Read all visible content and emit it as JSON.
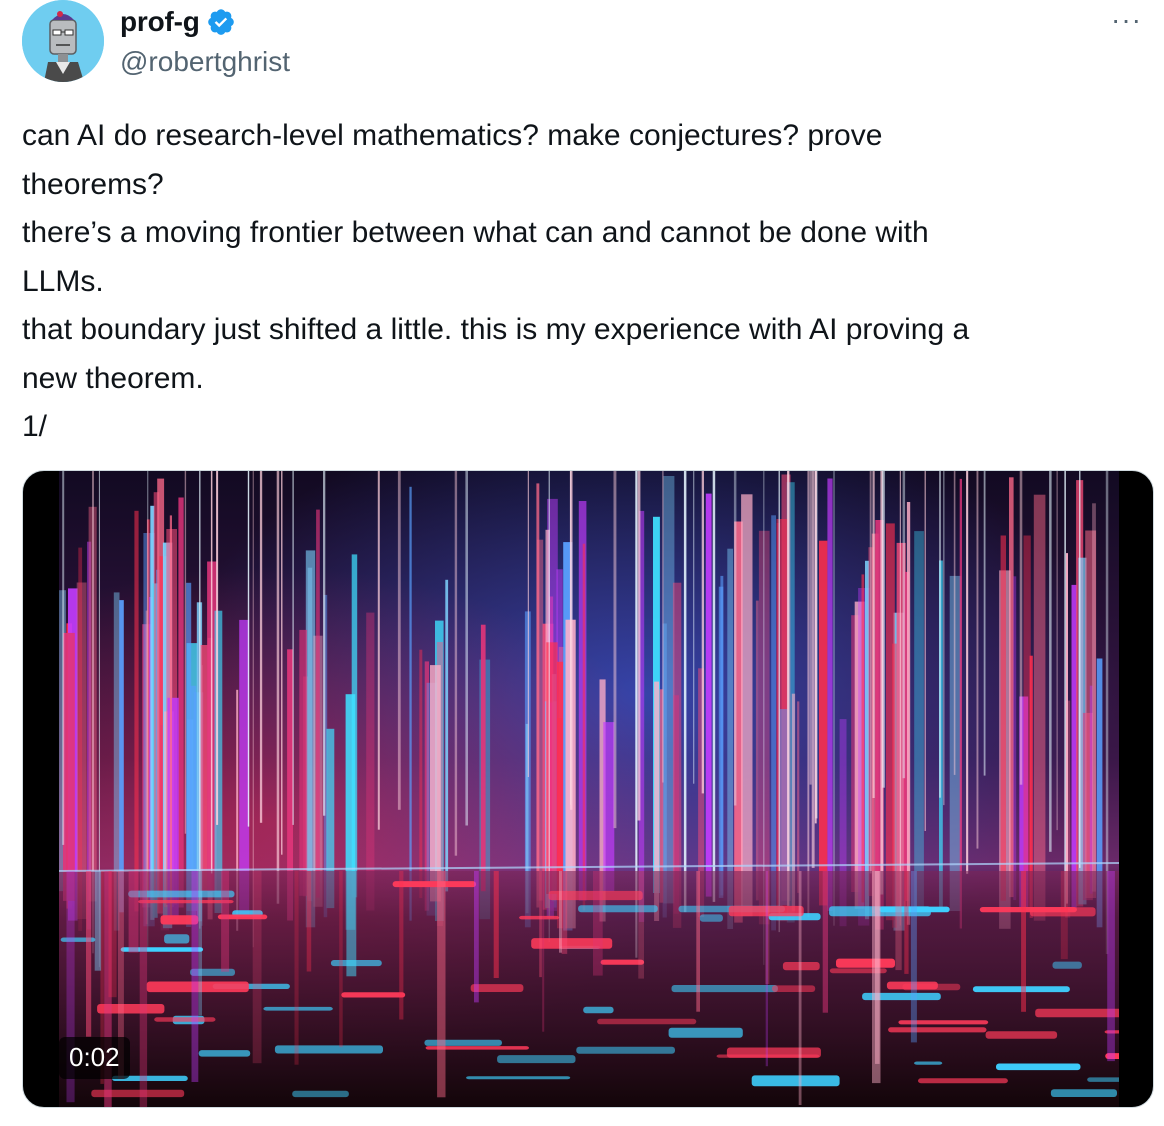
{
  "author": {
    "display_name": "prof-g",
    "handle": "@robertghrist",
    "verified": true,
    "avatar_icon": "robot-professor-avatar"
  },
  "menu": {
    "more_label": "···"
  },
  "tweet_text": {
    "lines": [
      "can AI do research-level mathematics? make conjectures? prove",
      "theorems?",
      "there’s a moving frontier between what can and cannot be done with",
      "LLMs.",
      "that boundary just shifted a little.  this is my experience with AI proving a",
      "new theorem.",
      "1/"
    ]
  },
  "media": {
    "type": "video",
    "duration": "0:02",
    "description_icon": "neon-digital-city-video"
  },
  "colors": {
    "verified_blue": "#1d9bf0",
    "text_primary": "#0f1419",
    "text_secondary": "#536471",
    "border": "#cfd9de"
  }
}
